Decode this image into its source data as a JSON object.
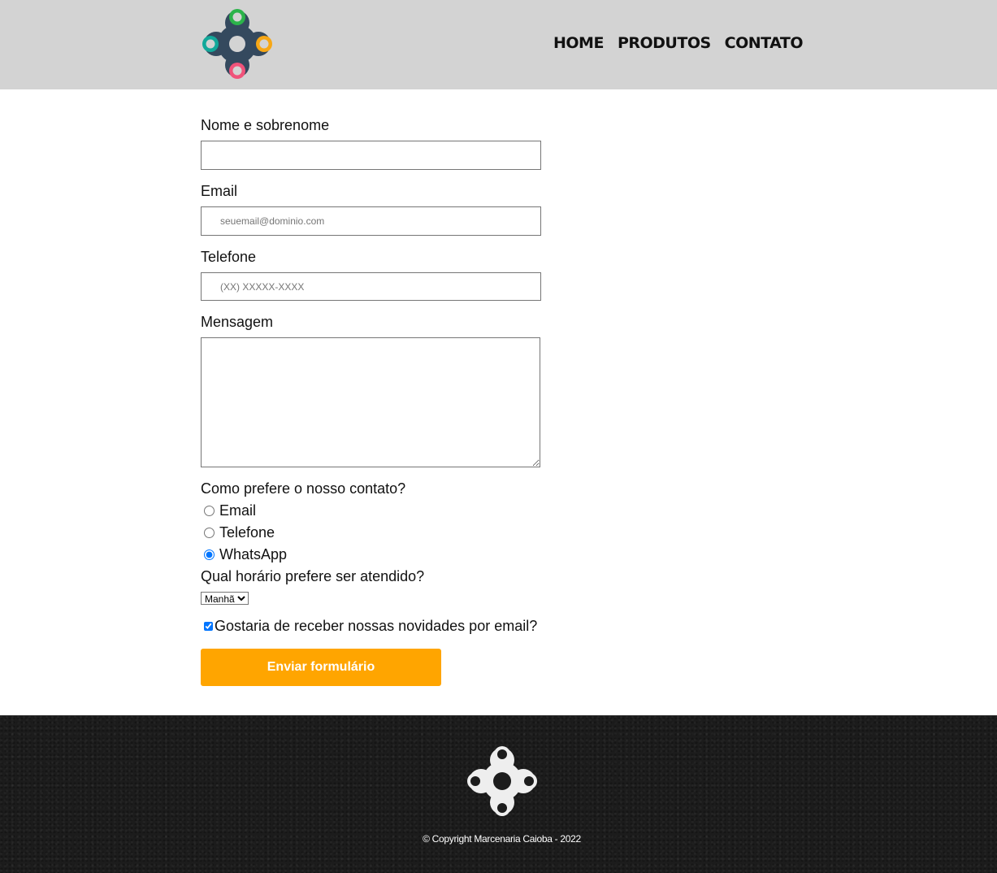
{
  "header": {
    "nav": [
      {
        "label": "HOME"
      },
      {
        "label": "PRODUTOS"
      },
      {
        "label": "CONTATO"
      }
    ]
  },
  "form": {
    "name_label": "Nome e sobrenome",
    "name_value": "",
    "email_label": "Email",
    "email_placeholder": "seuemail@dominio.com",
    "phone_label": "Telefone",
    "phone_placeholder": "(XX) XXXXX-XXXX",
    "message_label": "Mensagem",
    "contact_question": "Como prefere o nosso contato?",
    "contact_options": [
      {
        "label": "Email",
        "checked": false
      },
      {
        "label": "Telefone",
        "checked": false
      },
      {
        "label": "WhatsApp",
        "checked": true
      }
    ],
    "time_question": "Qual horário prefere ser atendido?",
    "time_selected": "Manhã",
    "newsletter_label": "Gostaria de receber nossas novidades por email?",
    "newsletter_checked": true,
    "submit_label": "Enviar formulário"
  },
  "footer": {
    "copyright": "© Copyright Marcenaria Caioba - 2022"
  },
  "colors": {
    "header_bg": "#d3d3d3",
    "submit_bg": "#ffa500",
    "footer_bg": "#1c1c1c",
    "logo_dark": "#34495e",
    "logo_green": "#2bb34a",
    "logo_teal": "#12a89a",
    "logo_yellow": "#f7a715",
    "logo_pink": "#f0537a"
  }
}
